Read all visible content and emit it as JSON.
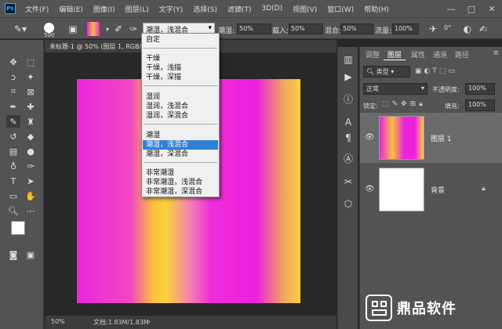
{
  "menubar": {
    "logo": "Ps",
    "items": [
      "文件(F)",
      "编辑(E)",
      "图像(I)",
      "图层(L)",
      "文字(Y)",
      "选择(S)",
      "滤镜(T)",
      "3D(D)",
      "视图(V)",
      "窗口(W)",
      "帮助(H)"
    ],
    "min": "—",
    "max": "□",
    "close": "✕"
  },
  "options": {
    "brush_size": "500",
    "blend_value": "潮湿，浅混合",
    "wet_label": "潮湿:",
    "wet_value": "50%",
    "load_label": "载入:",
    "load_value": "50%",
    "mix_label": "混合:",
    "mix_value": "50%",
    "flow_label": "流量:",
    "flow_value": "100%",
    "angle_value": "0°"
  },
  "dropdown": {
    "items": [
      "自定",
      "干燥",
      "干燥，浅描",
      "干燥，深描",
      "湿润",
      "湿润，浅混合",
      "湿润，深混合",
      "潮湿",
      "潮湿，浅混合",
      "潮湿，深混合",
      "非常潮湿",
      "非常潮湿，浅混合",
      "非常潮湿，深混合"
    ],
    "selected_index": 8
  },
  "document": {
    "tab_title": "未标题-1 @ 50% (图层 1, RGB/8",
    "zoom": "50%",
    "doc_info": "文档:1.83M/1.83M"
  },
  "panel": {
    "tabs": [
      "调整",
      "图层",
      "属性",
      "通道",
      "路径"
    ],
    "active_tab": "图层",
    "filter_label": "类型",
    "blend_mode": "正常",
    "opacity_label": "不透明度:",
    "opacity_value": "100%",
    "lock_label": "锁定:",
    "fill_label": "填充:",
    "fill_value": "100%",
    "layers": [
      {
        "name": "图层 1"
      },
      {
        "name": "背景"
      }
    ]
  },
  "watermark": {
    "text": "鼎品软件"
  },
  "colors": {
    "accent": "#2f7fd6",
    "canvas_magenta": "#ec26dc",
    "canvas_yellow": "#f7c13c"
  }
}
